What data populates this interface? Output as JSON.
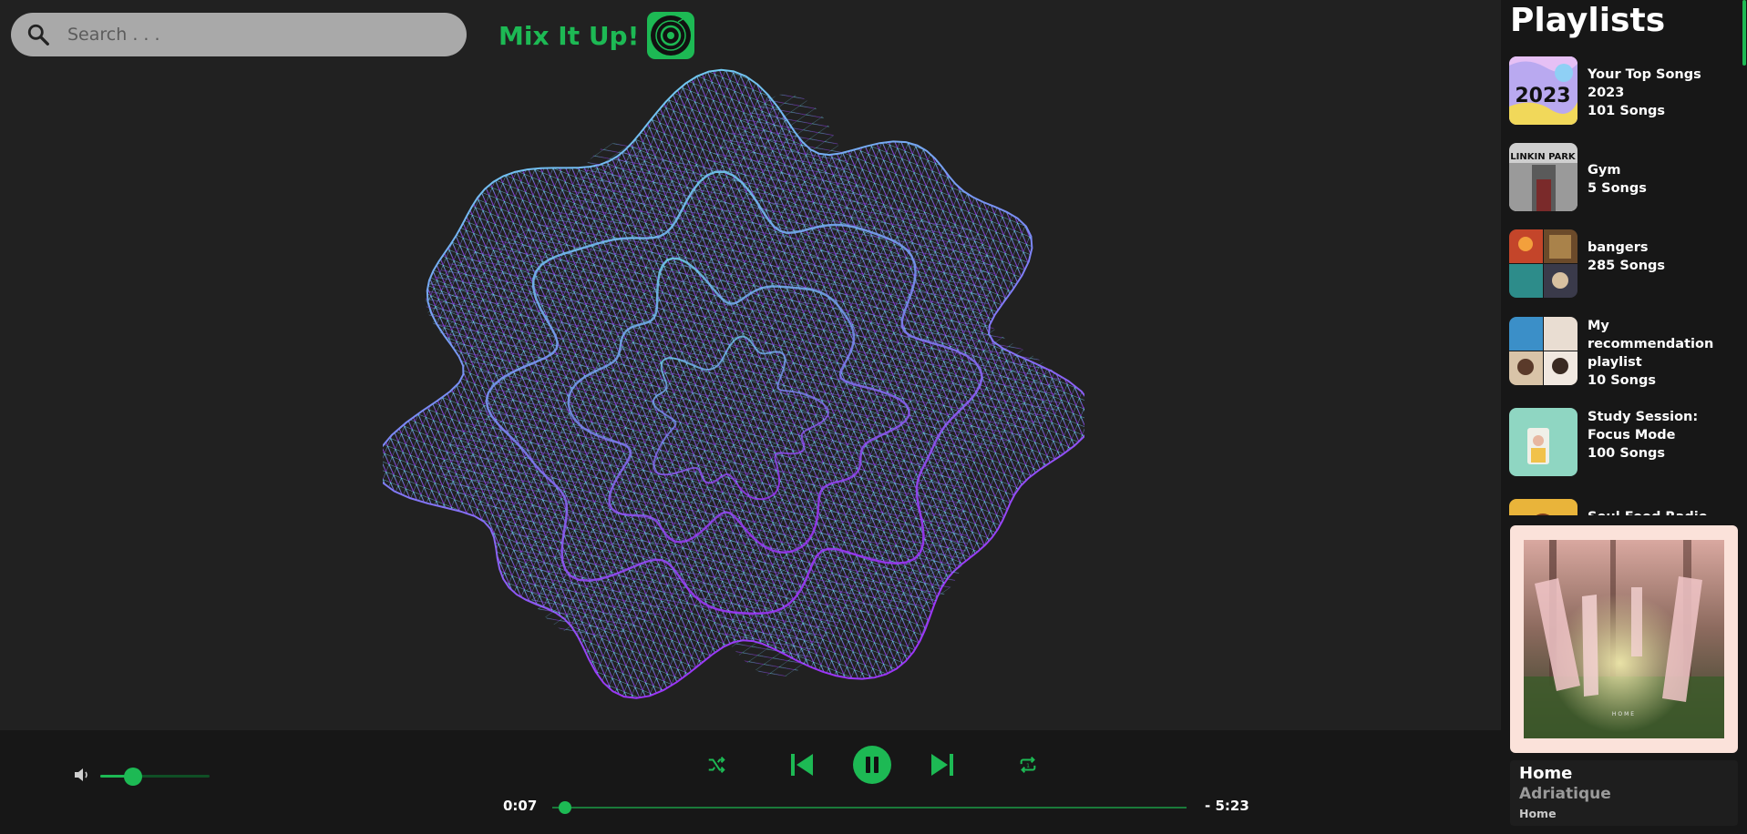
{
  "search": {
    "placeholder": "Search . . ."
  },
  "brand": {
    "title": "Mix It Up!"
  },
  "colors": {
    "accent": "#1db954",
    "background": "#212121",
    "sidebar": "#171717"
  },
  "sidebar": {
    "title": "Playlists",
    "playlists": [
      {
        "name": "Your Top Songs 2023",
        "count": "101 Songs",
        "cover_text": "2023"
      },
      {
        "name": "Gym",
        "count": "5 Songs",
        "cover_text": "LINKIN PARK"
      },
      {
        "name": "bangers",
        "count": "285 Songs"
      },
      {
        "name": "My recommendation playlist",
        "count": "10 Songs"
      },
      {
        "name": "Study Session: Focus Mode",
        "count": "100 Songs"
      },
      {
        "name": "Soul Food Radio",
        "count": ""
      }
    ]
  },
  "now_playing": {
    "title": "Home",
    "artist": "Adriatique",
    "album": "Home",
    "art_text": "HOME"
  },
  "player": {
    "elapsed": "0:07",
    "remaining": "- 5:23",
    "progress": 0.02,
    "volume": 0.3,
    "icons": [
      "volume-icon",
      "shuffle-icon",
      "previous-icon",
      "pause-icon",
      "next-icon",
      "repeat-icon"
    ]
  }
}
